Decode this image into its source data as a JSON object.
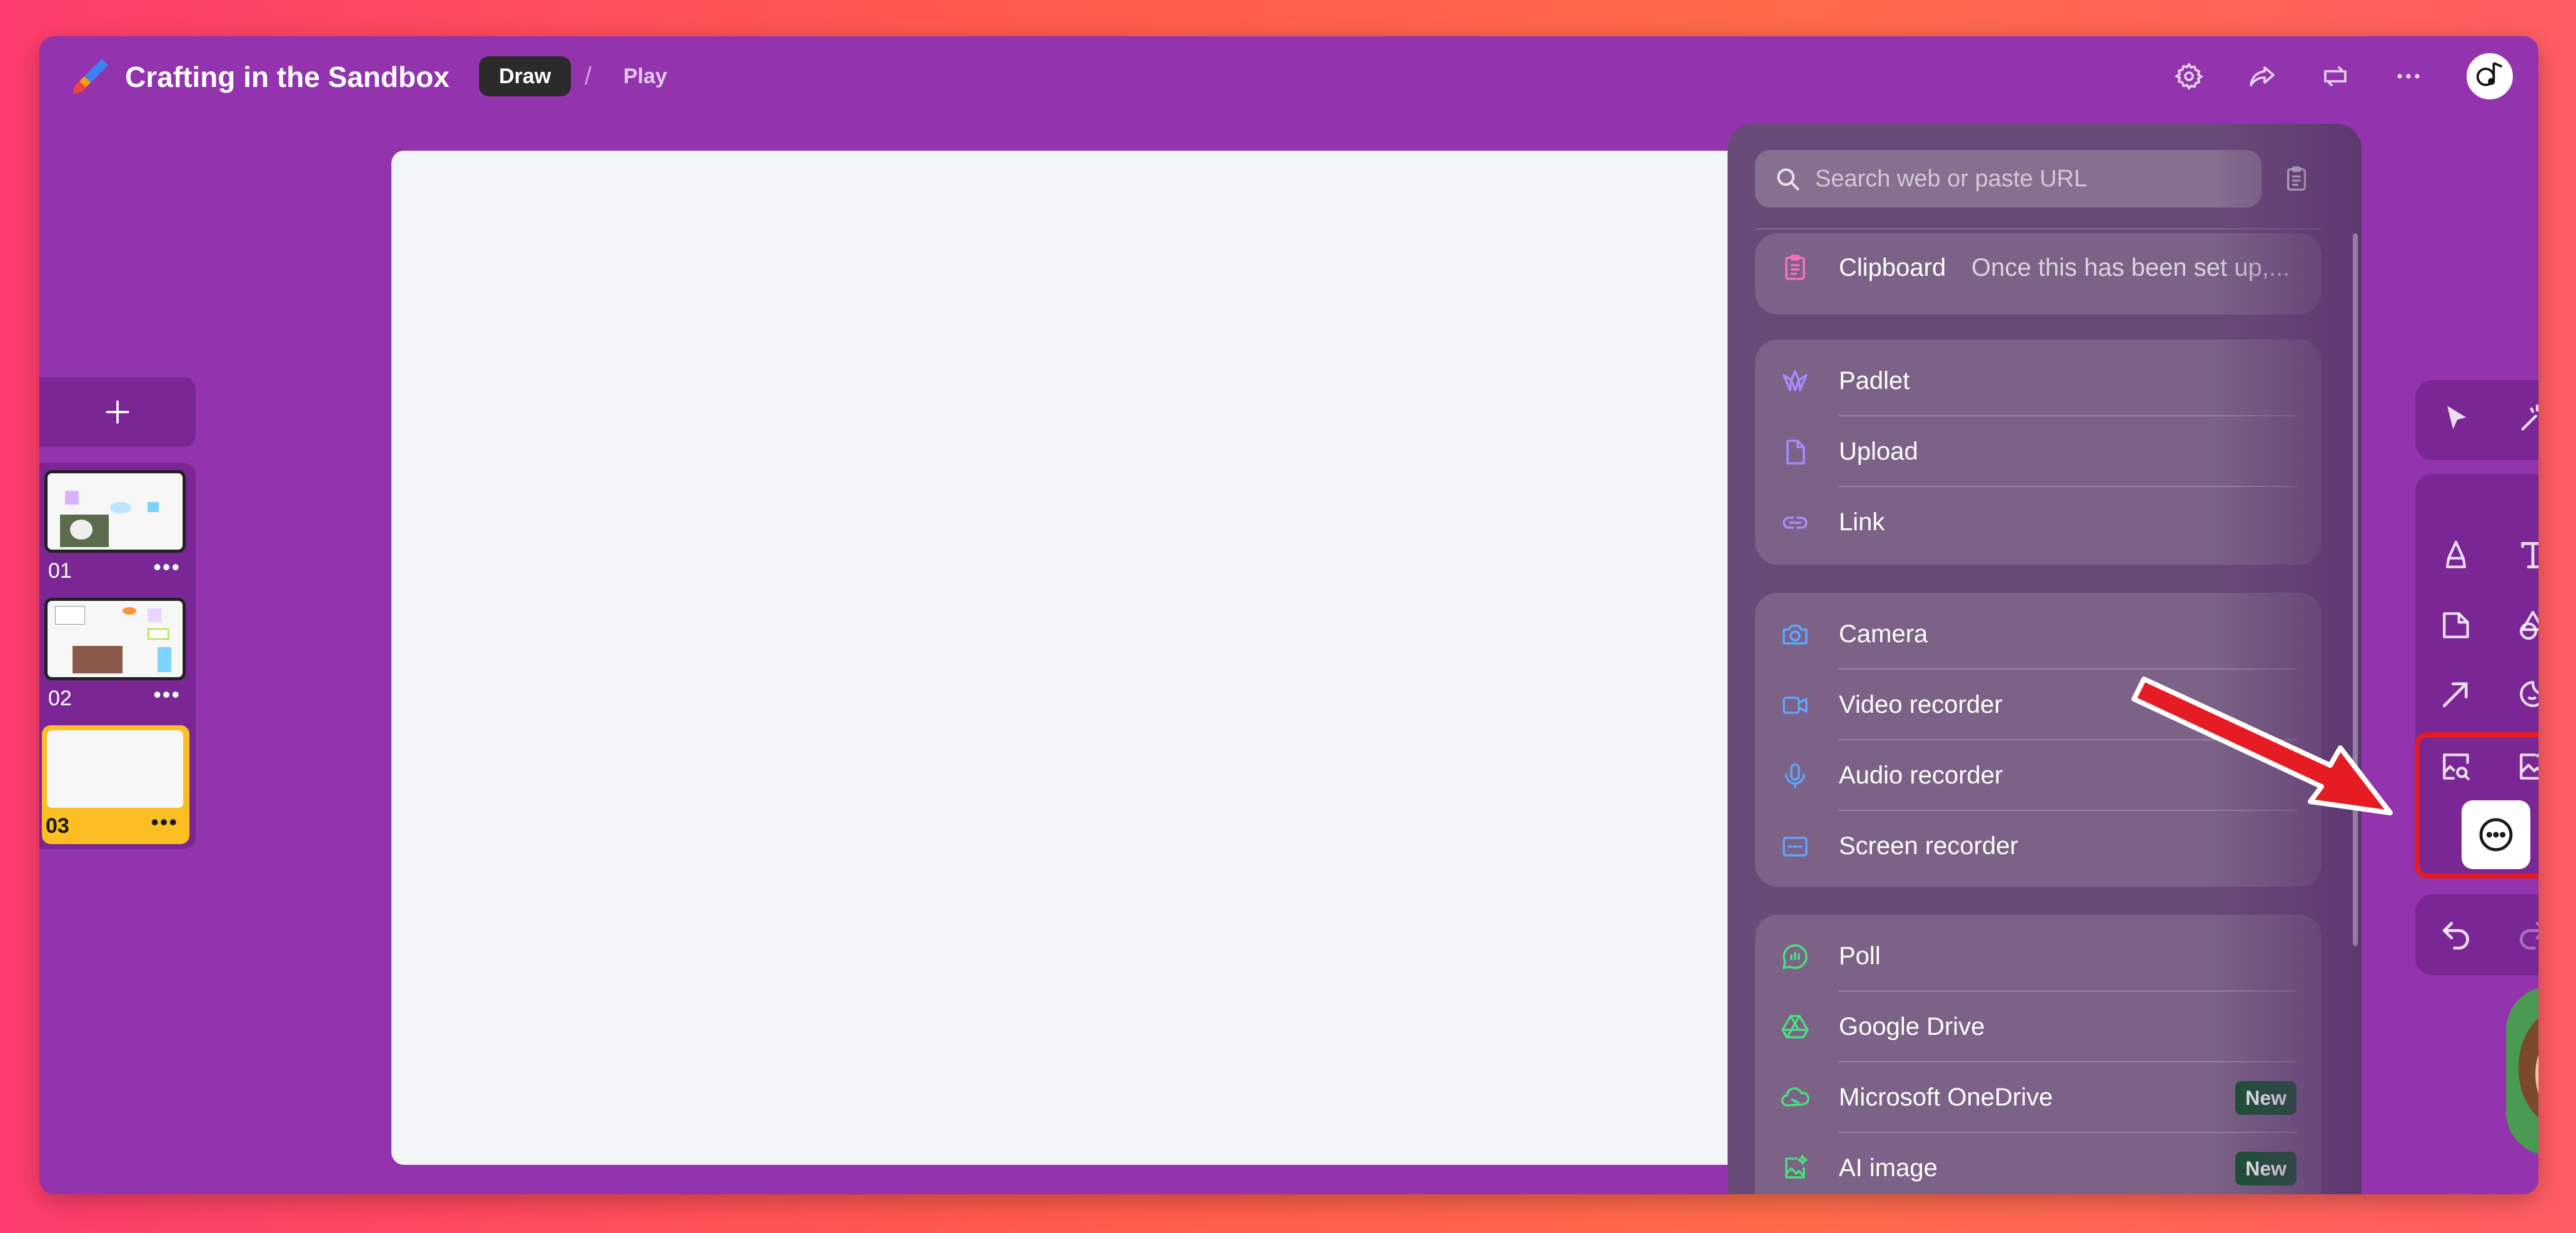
{
  "header": {
    "title": "Crafting in the Sandbox",
    "mode_draw": "Draw",
    "mode_separator": "/",
    "mode_play": "Play",
    "icons": [
      "settings-icon",
      "share-icon",
      "remake-icon",
      "more-icon",
      "avatar"
    ]
  },
  "slides": {
    "add_label": "+",
    "items": [
      {
        "label": "01",
        "menu": "•••",
        "active": false
      },
      {
        "label": "02",
        "menu": "•••",
        "active": false
      },
      {
        "label": "03",
        "menu": "•••",
        "active": true
      }
    ]
  },
  "panel": {
    "search_placeholder": "Search web or paste URL",
    "groups": [
      {
        "items": [
          {
            "label": "Clipboard",
            "sub": "Once this has been set up,...",
            "icon": "clipboard-icon",
            "color": "#f472b6"
          }
        ]
      },
      {
        "items": [
          {
            "label": "Padlet",
            "icon": "padlet-icon",
            "color": "#a78bfa"
          },
          {
            "label": "Upload",
            "icon": "upload-icon",
            "color": "#a78bfa"
          },
          {
            "label": "Link",
            "icon": "link-icon",
            "color": "#a78bfa"
          }
        ]
      },
      {
        "items": [
          {
            "label": "Camera",
            "icon": "camera-icon",
            "color": "#60a5fa"
          },
          {
            "label": "Video recorder",
            "icon": "video-icon",
            "color": "#60a5fa"
          },
          {
            "label": "Audio recorder",
            "icon": "microphone-icon",
            "color": "#60a5fa"
          },
          {
            "label": "Screen recorder",
            "icon": "screen-recorder-icon",
            "color": "#60a5fa"
          }
        ]
      },
      {
        "items": [
          {
            "label": "Poll",
            "icon": "poll-icon",
            "color": "#4ade80"
          },
          {
            "label": "Google Drive",
            "icon": "google-drive-icon",
            "color": "#4ade80"
          },
          {
            "label": "Microsoft OneDrive",
            "icon": "onedrive-icon",
            "color": "#4ade80",
            "badge": "New"
          },
          {
            "label": "AI image",
            "icon": "ai-image-icon",
            "color": "#4ade80",
            "badge": "New"
          }
        ]
      }
    ]
  },
  "toolbar": {
    "tools": [
      "select-icon",
      "magic-icon",
      "pen-icon",
      "text-icon",
      "sticky-note-icon",
      "shapes-icon",
      "arrow-line-icon",
      "sticker-icon",
      "image-search-icon",
      "ai-image-tool-icon",
      "more-options-icon",
      "undo-icon",
      "redo-icon"
    ]
  },
  "colors": {
    "background_purple": "#9333ae",
    "panel": "#694b7a",
    "badge_green": "#14532d",
    "highlight_red": "#e51c24",
    "active_slide": "#fbbf24"
  }
}
